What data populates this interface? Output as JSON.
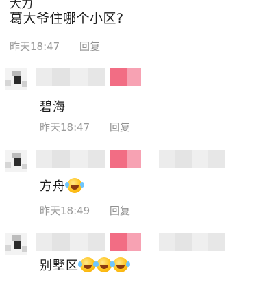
{
  "top_partial_text": "大力",
  "main_comment": {
    "text": "葛大爷住哪个小区?",
    "time": "昨天18:47",
    "reply_label": "回复"
  },
  "replies": [
    {
      "text": "碧海",
      "emoji_count": 0,
      "time": "昨天18:47",
      "reply_label": "回复"
    },
    {
      "text": "方舟",
      "emoji_count": 1,
      "time": "昨天18:49",
      "reply_label": "回复"
    },
    {
      "text": "别墅区",
      "emoji_count": 3
    }
  ],
  "colors": {
    "meta_text": "#9a9a9a",
    "blur_pink": "#f26d84",
    "emoji": "laughing-crying-emoji"
  }
}
